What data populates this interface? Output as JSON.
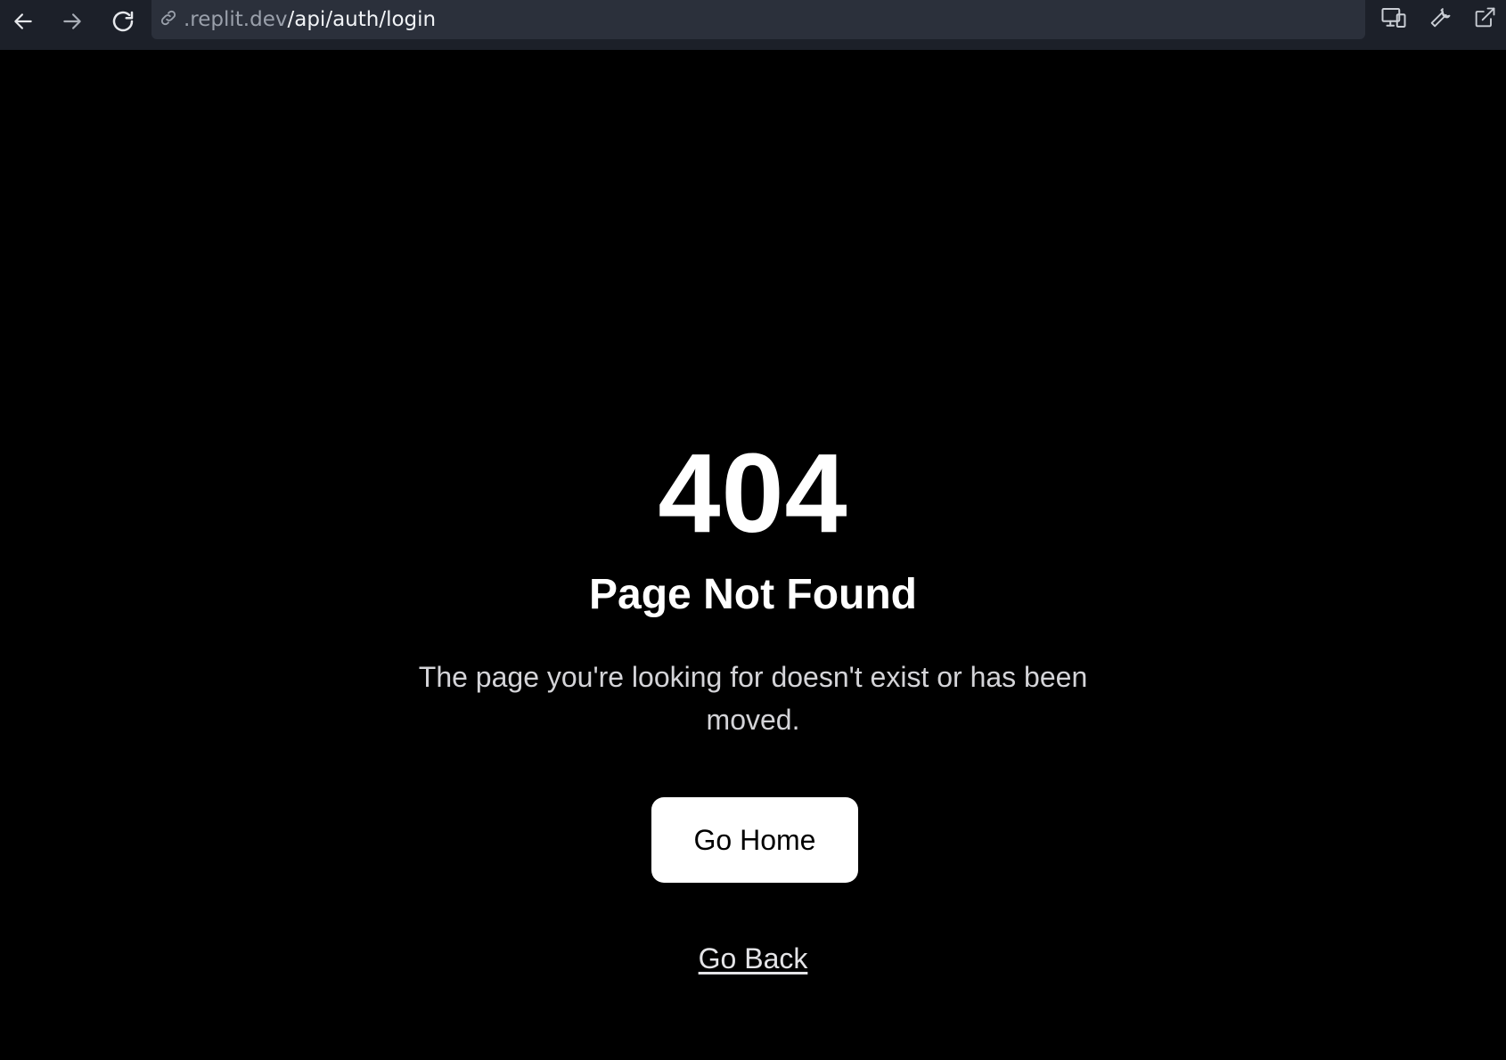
{
  "browser": {
    "back_icon": "arrow-left-icon",
    "forward_icon": "arrow-right-icon",
    "reload_icon": "reload-icon",
    "link_icon": "link-icon",
    "url_host": ".replit.dev",
    "url_path": "/api/auth/login",
    "devices_icon": "devices-icon",
    "wrench_icon": "wrench-icon",
    "open_external_icon": "external-link-icon"
  },
  "page": {
    "error_code": "404",
    "title": "Page Not Found",
    "message": "The page you're looking for doesn't exist or has been moved.",
    "home_button": "Go Home",
    "back_link": "Go Back"
  },
  "colors": {
    "background": "#000000",
    "toolbar": "#1c2029",
    "urlbar": "#2b303b",
    "button_bg": "#ffffff",
    "text_primary": "#ffffff",
    "text_secondary": "#d4d4d8"
  }
}
